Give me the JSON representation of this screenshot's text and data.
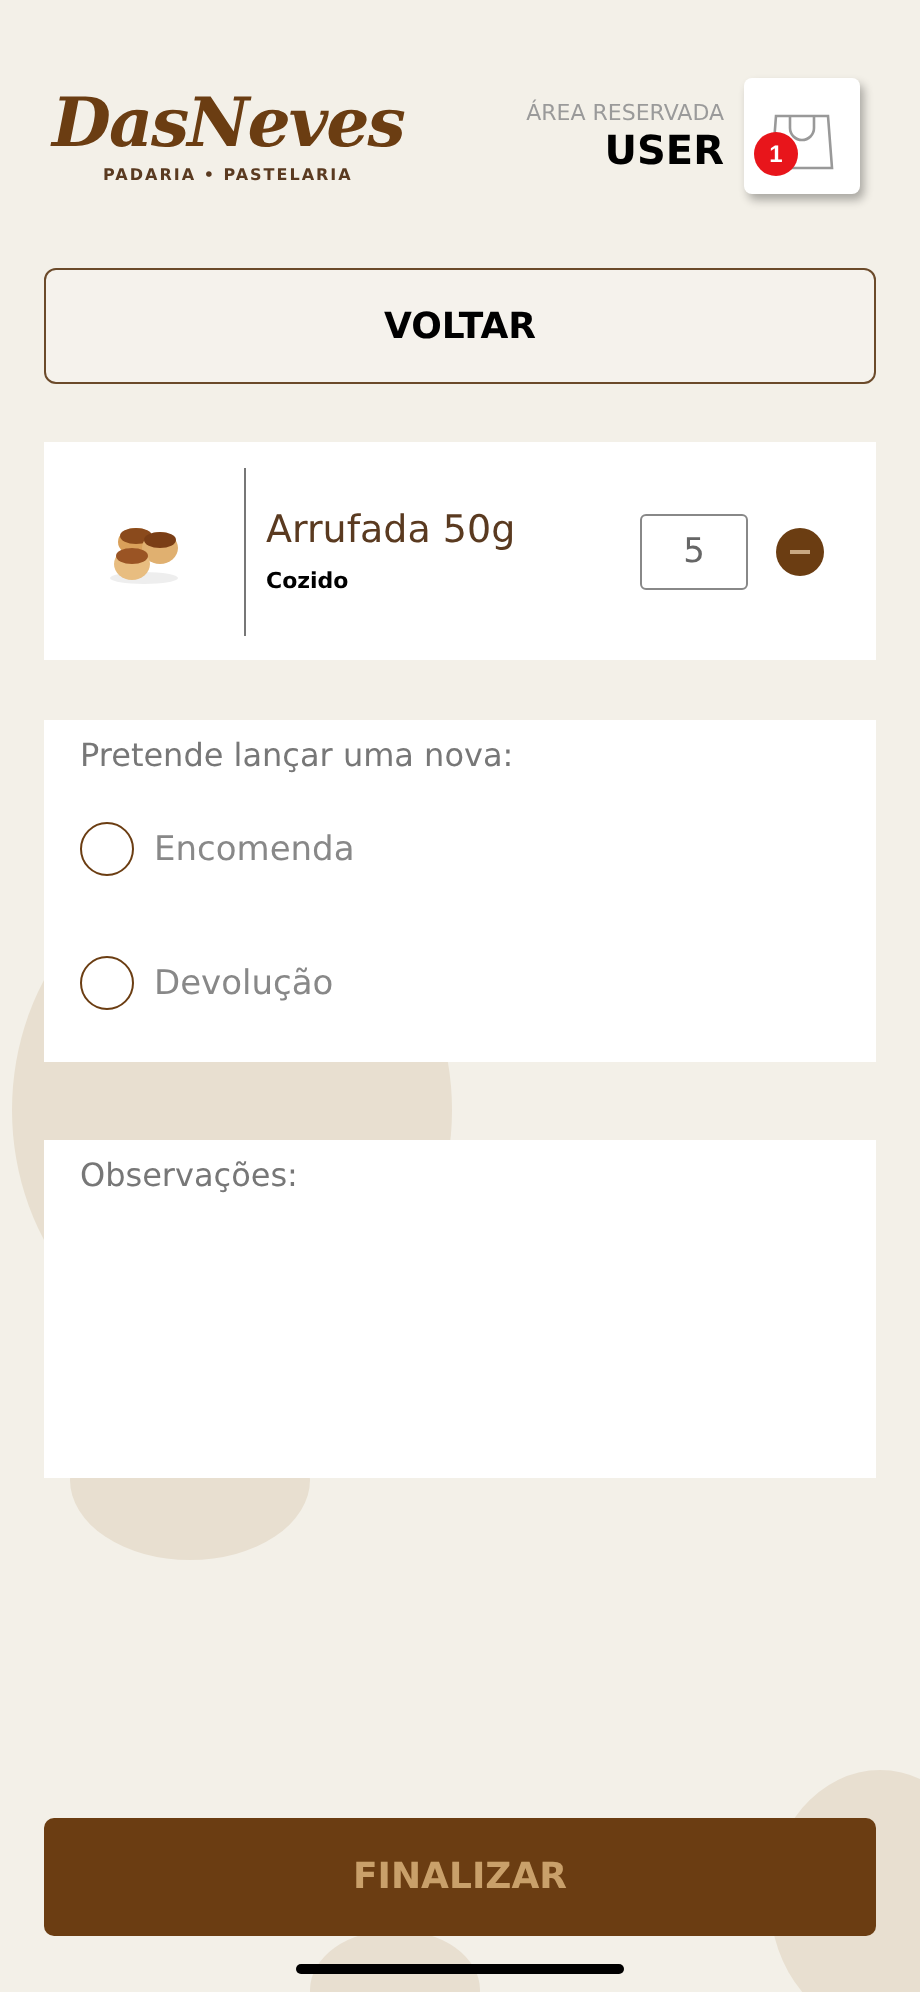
{
  "logo": {
    "name": "DasNeves",
    "tagline": "PADARIA • PASTELARIA"
  },
  "account": {
    "label": "ÁREA RESERVADA",
    "user": "USER",
    "cart_count": "1"
  },
  "back_button": "VOLTAR",
  "product": {
    "name": "Arrufada 50g",
    "state": "Cozido",
    "quantity": "5"
  },
  "order_type": {
    "question": "Pretende lançar uma nova:",
    "options": [
      {
        "label": "Encomenda",
        "selected": false
      },
      {
        "label": "Devolução",
        "selected": false
      }
    ]
  },
  "notes": {
    "placeholder": "Observações:"
  },
  "finish_button": "FINALIZAR"
}
